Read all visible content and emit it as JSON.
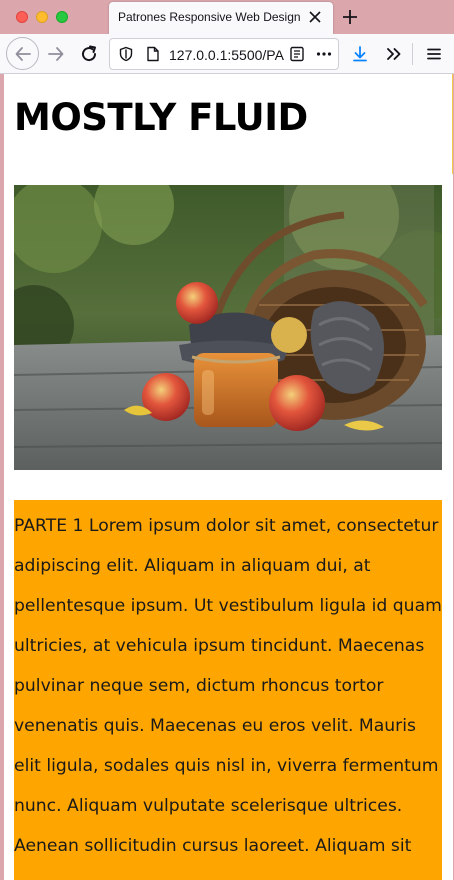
{
  "browser": {
    "tab_title": "Patrones Responsive Web Design",
    "url": "127.0.0.1:5500/PA",
    "icons": {
      "tab_close": "close-icon",
      "new_tab": "plus-icon",
      "back": "arrow-left-icon",
      "forward": "arrow-right-icon",
      "reload": "reload-icon",
      "shield": "shield-icon",
      "page": "page-icon",
      "reader": "reader-view-icon",
      "more": "dots-icon",
      "download": "download-icon",
      "overflow": "chevrons-right-icon",
      "menu": "hamburger-menu-icon"
    },
    "colors": {
      "tabbar": "#dba7ad",
      "toolbar": "#f9f9fb",
      "download_accent": "#0a84ff"
    }
  },
  "page": {
    "heading": "MOSTLY FLUID",
    "photo": "apples-basket-jar-photo",
    "paragraph": "PARTE 1 Lorem ipsum dolor sit amet, consectetur adipiscing elit. Aliquam in aliquam dui, at pellentesque ipsum. Ut vestibulum ligula id quam ultricies, at vehicula ipsum tincidunt. Maecenas pulvinar neque sem, dictum rhoncus tortor venenatis quis. Maecenas eu eros velit. Mauris elit ligula, sodales quis nisl in, viverra fermentum nunc. Aliquam vulputate scelerisque ultrices. Aenean sollicitudin cursus laoreet. Aliquam sit",
    "colors": {
      "text_block_bg": "#ffa500",
      "heading": "#000000"
    }
  }
}
